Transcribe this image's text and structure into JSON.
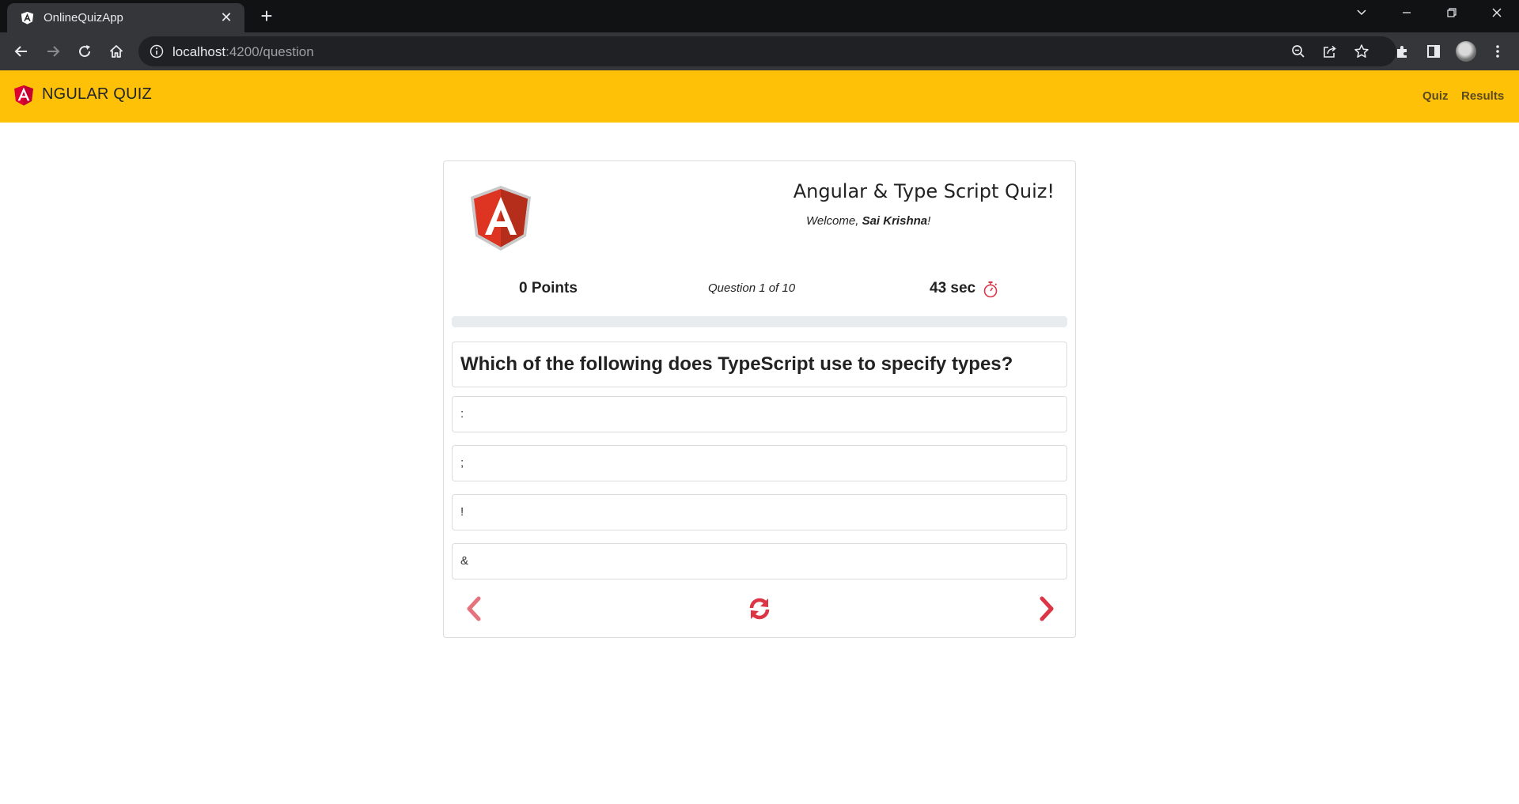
{
  "browser": {
    "tab_title": "OnlineQuizApp",
    "url_host": "localhost",
    "url_path": ":4200/question"
  },
  "navbar": {
    "brand_text": "NGULAR QUIZ",
    "links": [
      "Quiz",
      "Results"
    ]
  },
  "quiz": {
    "title": "Angular & Type Script Quiz!",
    "welcome_prefix": "Welcome, ",
    "user_name": "Sai Krishna",
    "welcome_suffix": "!",
    "points_label": "0 Points",
    "question_counter": "Question 1 of 10",
    "timer_label": "43 sec",
    "progress_fraction": 0,
    "question_text": "Which of the following does TypeScript use to specify types?",
    "options": [
      ":",
      ";",
      "!",
      "&"
    ]
  },
  "colors": {
    "navbar": "#ffc107",
    "angular_red": "#dd0031",
    "control_red": "#dc3545"
  },
  "icons": {
    "prev": "chevron-left-icon",
    "reset": "refresh-icon",
    "next": "chevron-right-icon",
    "timer": "stopwatch-icon"
  }
}
